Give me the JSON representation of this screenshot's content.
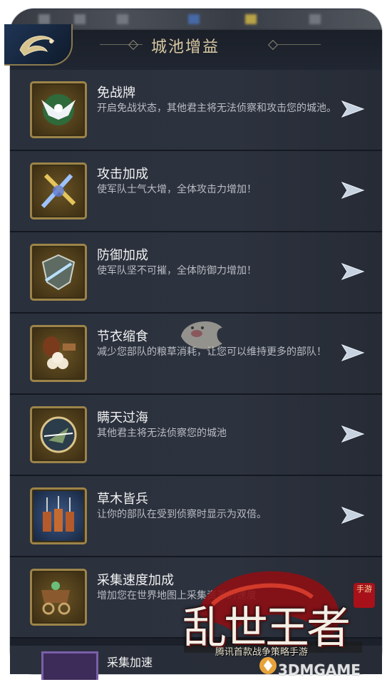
{
  "header": {
    "title": "城池增益"
  },
  "items": [
    {
      "title": "免战牌",
      "desc": "开启免战状态，其他君主将无法侦察和攻击您的城池。",
      "icon": "dove-icon"
    },
    {
      "title": "攻击加成",
      "desc": "使军队士气大增，全体攻击力增加！",
      "icon": "swords-icon"
    },
    {
      "title": "防御加成",
      "desc": "使军队坚不可摧，全体防御力增加！",
      "icon": "shield-icon"
    },
    {
      "title": "节衣缩食",
      "desc": "减少您部队的粮草消耗，让您可以维持更多的部队！",
      "icon": "food-icon"
    },
    {
      "title": "瞒天过海",
      "desc": "其他君主将无法侦察您的城池",
      "icon": "compass-icon"
    },
    {
      "title": "草木皆兵",
      "desc": "让你的部队在受到侦察时显示为双倍。",
      "icon": "soldiers-icon"
    },
    {
      "title": "采集速度加成",
      "desc": "增加您在世界地图上采集资源的速度",
      "icon": "cart-icon"
    },
    {
      "title": "采集加速",
      "desc": "",
      "icon": "gather-icon"
    }
  ],
  "logo": {
    "main": "乱世王者",
    "badge": "手游",
    "sub": "腾讯首款战争策略手游"
  },
  "watermark": "3DMGAME",
  "colors": {
    "accent_gold": "#9c8449",
    "bg": "#1b2029",
    "arrow": "#c7d2e0"
  }
}
